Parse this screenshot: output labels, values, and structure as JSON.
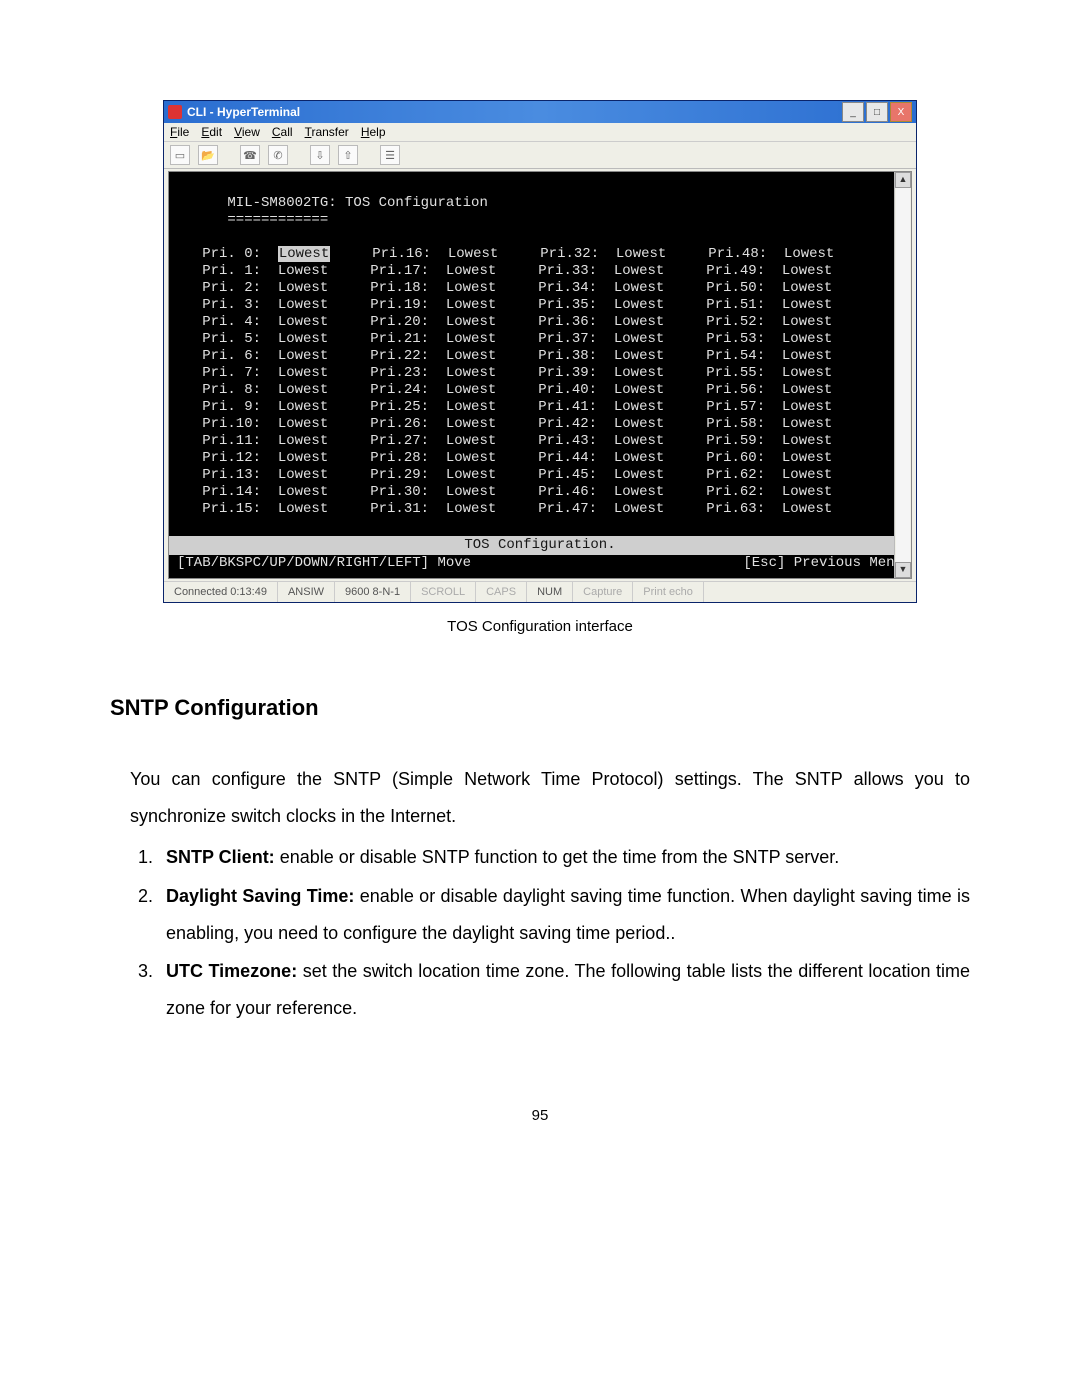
{
  "window": {
    "title": "CLI - HyperTerminal",
    "menus": {
      "file": "File",
      "edit": "Edit",
      "view": "View",
      "call": "Call",
      "transfer": "Transfer",
      "help": "Help"
    },
    "ctrl": {
      "min": "_",
      "max": "□",
      "close": "X"
    }
  },
  "terminal": {
    "heading": "MIL-SM8002TG: TOS Configuration",
    "underline": "============",
    "bar": "TOS Configuration.",
    "hint_left": "[TAB/BKSPC/UP/DOWN/RIGHT/LEFT] Move",
    "hint_right": "[Esc] Previous Menu",
    "columns": [
      [
        {
          "label": "Pri. 0:",
          "value": "Lowest",
          "selected": true
        },
        {
          "label": "Pri. 1:",
          "value": "Lowest"
        },
        {
          "label": "Pri. 2:",
          "value": "Lowest"
        },
        {
          "label": "Pri. 3:",
          "value": "Lowest"
        },
        {
          "label": "Pri. 4:",
          "value": "Lowest"
        },
        {
          "label": "Pri. 5:",
          "value": "Lowest"
        },
        {
          "label": "Pri. 6:",
          "value": "Lowest"
        },
        {
          "label": "Pri. 7:",
          "value": "Lowest"
        },
        {
          "label": "Pri. 8:",
          "value": "Lowest"
        },
        {
          "label": "Pri. 9:",
          "value": "Lowest"
        },
        {
          "label": "Pri.10:",
          "value": "Lowest"
        },
        {
          "label": "Pri.11:",
          "value": "Lowest"
        },
        {
          "label": "Pri.12:",
          "value": "Lowest"
        },
        {
          "label": "Pri.13:",
          "value": "Lowest"
        },
        {
          "label": "Pri.14:",
          "value": "Lowest"
        },
        {
          "label": "Pri.15:",
          "value": "Lowest"
        }
      ],
      [
        {
          "label": "Pri.16:",
          "value": "Lowest"
        },
        {
          "label": "Pri.17:",
          "value": "Lowest"
        },
        {
          "label": "Pri.18:",
          "value": "Lowest"
        },
        {
          "label": "Pri.19:",
          "value": "Lowest"
        },
        {
          "label": "Pri.20:",
          "value": "Lowest"
        },
        {
          "label": "Pri.21:",
          "value": "Lowest"
        },
        {
          "label": "Pri.22:",
          "value": "Lowest"
        },
        {
          "label": "Pri.23:",
          "value": "Lowest"
        },
        {
          "label": "Pri.24:",
          "value": "Lowest"
        },
        {
          "label": "Pri.25:",
          "value": "Lowest"
        },
        {
          "label": "Pri.26:",
          "value": "Lowest"
        },
        {
          "label": "Pri.27:",
          "value": "Lowest"
        },
        {
          "label": "Pri.28:",
          "value": "Lowest"
        },
        {
          "label": "Pri.29:",
          "value": "Lowest"
        },
        {
          "label": "Pri.30:",
          "value": "Lowest"
        },
        {
          "label": "Pri.31:",
          "value": "Lowest"
        }
      ],
      [
        {
          "label": "Pri.32:",
          "value": "Lowest"
        },
        {
          "label": "Pri.33:",
          "value": "Lowest"
        },
        {
          "label": "Pri.34:",
          "value": "Lowest"
        },
        {
          "label": "Pri.35:",
          "value": "Lowest"
        },
        {
          "label": "Pri.36:",
          "value": "Lowest"
        },
        {
          "label": "Pri.37:",
          "value": "Lowest"
        },
        {
          "label": "Pri.38:",
          "value": "Lowest"
        },
        {
          "label": "Pri.39:",
          "value": "Lowest"
        },
        {
          "label": "Pri.40:",
          "value": "Lowest"
        },
        {
          "label": "Pri.41:",
          "value": "Lowest"
        },
        {
          "label": "Pri.42:",
          "value": "Lowest"
        },
        {
          "label": "Pri.43:",
          "value": "Lowest"
        },
        {
          "label": "Pri.44:",
          "value": "Lowest"
        },
        {
          "label": "Pri.45:",
          "value": "Lowest"
        },
        {
          "label": "Pri.46:",
          "value": "Lowest"
        },
        {
          "label": "Pri.47:",
          "value": "Lowest"
        }
      ],
      [
        {
          "label": "Pri.48:",
          "value": "Lowest"
        },
        {
          "label": "Pri.49:",
          "value": "Lowest"
        },
        {
          "label": "Pri.50:",
          "value": "Lowest"
        },
        {
          "label": "Pri.51:",
          "value": "Lowest"
        },
        {
          "label": "Pri.52:",
          "value": "Lowest"
        },
        {
          "label": "Pri.53:",
          "value": "Lowest"
        },
        {
          "label": "Pri.54:",
          "value": "Lowest"
        },
        {
          "label": "Pri.55:",
          "value": "Lowest"
        },
        {
          "label": "Pri.56:",
          "value": "Lowest"
        },
        {
          "label": "Pri.57:",
          "value": "Lowest"
        },
        {
          "label": "Pri.58:",
          "value": "Lowest"
        },
        {
          "label": "Pri.59:",
          "value": "Lowest"
        },
        {
          "label": "Pri.60:",
          "value": "Lowest"
        },
        {
          "label": "Pri.62:",
          "value": "Lowest"
        },
        {
          "label": "Pri.62:",
          "value": "Lowest"
        },
        {
          "label": "Pri.63:",
          "value": "Lowest"
        }
      ]
    ]
  },
  "statusbar": {
    "connected": "Connected 0:13:49",
    "term": "ANSIW",
    "params": "9600 8-N-1",
    "scroll": "SCROLL",
    "caps": "CAPS",
    "num": "NUM",
    "capture": "Capture",
    "echo": "Print echo"
  },
  "doc": {
    "caption": "TOS Configuration interface",
    "heading": "SNTP Configuration",
    "intro": "You can configure the SNTP (Simple Network Time Protocol) settings. The SNTP allows you to synchronize switch clocks in the Internet.",
    "items": [
      {
        "b": "SNTP Client:",
        "t": " enable or disable SNTP function to get the time from the SNTP server."
      },
      {
        "b": "Daylight Saving Time:",
        "t": " enable or disable daylight saving time function. When daylight saving time is enabling, you need to configure the daylight saving time period.."
      },
      {
        "b": "UTC Timezone:",
        "t": " set the switch location time zone. The following table lists the different location time zone for your reference."
      }
    ],
    "pagenum": "95"
  }
}
